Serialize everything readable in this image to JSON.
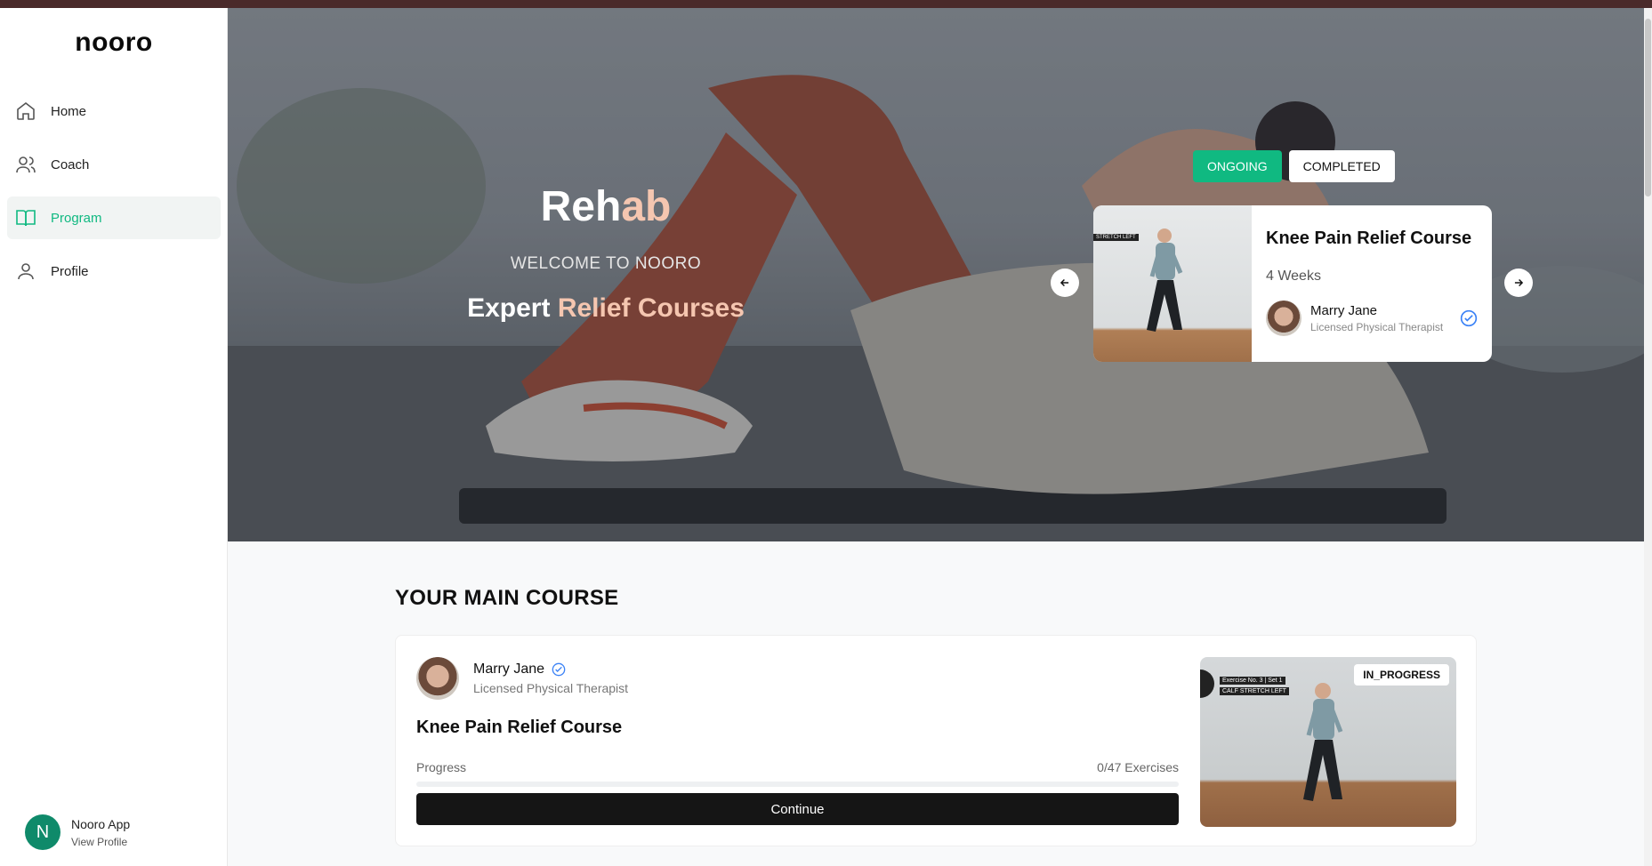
{
  "app": {
    "logo": "nooro"
  },
  "sidebar": {
    "items": [
      {
        "label": "Home",
        "icon": "home-icon",
        "active": false
      },
      {
        "label": "Coach",
        "icon": "users-icon",
        "active": false
      },
      {
        "label": "Program",
        "icon": "book-icon",
        "active": true
      },
      {
        "label": "Profile",
        "icon": "user-icon",
        "active": false
      }
    ],
    "user": {
      "initial": "N",
      "name": "Nooro App",
      "link": "View Profile"
    }
  },
  "hero": {
    "title_part1": "Reh",
    "title_part2": "ab",
    "welcome": "WELCOME TO NOORO",
    "subtitle_part1": "Expert ",
    "subtitle_part2": "Relief Courses",
    "tabs": {
      "ongoing": "ONGOING",
      "completed": "COMPLETED",
      "selected": "ONGOING"
    },
    "card": {
      "title": "Knee Pain Relief Course",
      "duration": "4 Weeks",
      "coach_name": "Marry Jane",
      "coach_role": "Licensed Physical Therapist",
      "image_overlay": "STRETCH LEFT"
    }
  },
  "main": {
    "section_title": "YOUR MAIN COURSE",
    "coach_name": "Marry Jane",
    "coach_role": "Licensed Physical Therapist",
    "course_title": "Knee Pain Relief Course",
    "progress_label": "Progress",
    "progress_value": "0/47 Exercises",
    "progress_fraction": 0,
    "continue_label": "Continue",
    "status": "IN_PROGRESS",
    "image_overlay_1": "Exercise No. 3 | Set 1",
    "image_overlay_2": "CALF STRETCH LEFT"
  },
  "colors": {
    "accent": "#10b981",
    "dark": "#151515",
    "peach": "#f5c6b0"
  }
}
